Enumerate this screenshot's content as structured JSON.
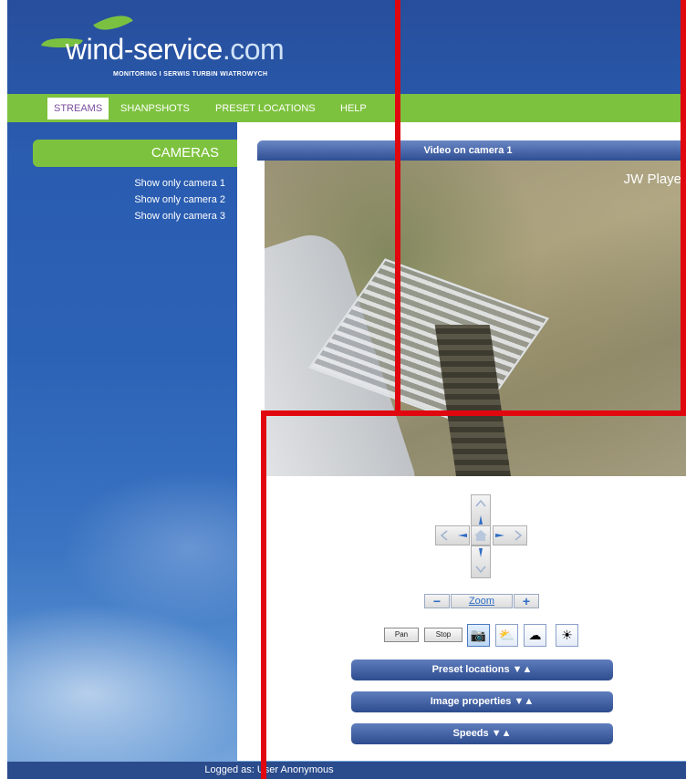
{
  "header": {
    "logo_brand": "wind-service",
    "logo_tld": ".com",
    "logo_tagline": "MONITORING I SERWIS TURBIN WIATROWYCH"
  },
  "nav": {
    "tabs": [
      "STREAMS",
      "SHANPSHOTS",
      "PRESET LOCATIONS",
      "HELP"
    ],
    "active": "STREAMS"
  },
  "sidebar": {
    "title": "CAMERAS",
    "items": [
      "Show only camera 1",
      "Show only camera 2",
      "Show only camera 3"
    ]
  },
  "video": {
    "title": "Video on camera 1",
    "player_watermark": "JW Player"
  },
  "controls": {
    "zoom_label": "Zoom",
    "zoom_out": "−",
    "zoom_in": "+",
    "pan_label": "Pan",
    "stop_label": "Stop",
    "icons": [
      "camera-icon",
      "cloud-sun-icon",
      "cloud-moon-icon",
      "night-sun-icon"
    ],
    "icon_glyphs": [
      "📷",
      "⛅",
      "☁",
      "☀"
    ]
  },
  "sections": {
    "preset_locations": "Preset locations ▼▲",
    "image_properties": "Image properties ▼▲",
    "speeds": "Speeds ▼▲"
  },
  "footer": {
    "logged_in_text": "Logged as: User Anonymous"
  },
  "colors": {
    "brand_green": "#7dc23e",
    "nav_blue": "#2c4c8f",
    "highlight_red": "#e0070e"
  }
}
